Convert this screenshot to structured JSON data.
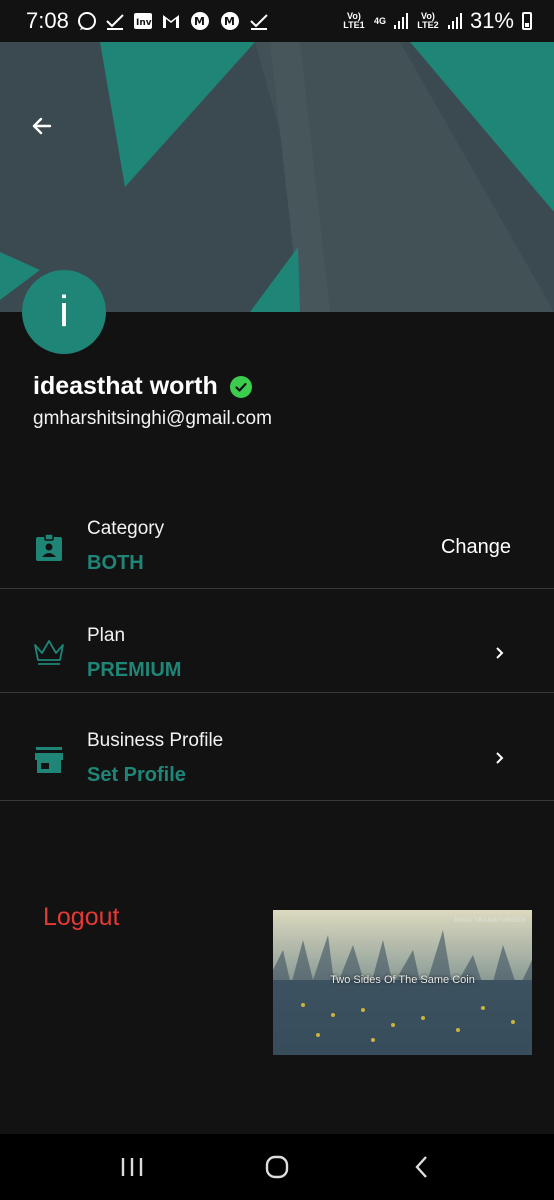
{
  "status_bar": {
    "time": "7:08",
    "battery": "31%",
    "sim1_label": "Vo) LTE1",
    "sim1_net": "4G",
    "sim2_label": "Vo) LTE2",
    "notification_icons": [
      "whatsapp-icon",
      "check-icon",
      "inv-icon",
      "gmail-icon",
      "m-icon",
      "m-icon",
      "check-icon"
    ]
  },
  "profile": {
    "avatar_letter": "i",
    "name": "ideasthat worth",
    "email": "gmharshitsinghi@gmail.com"
  },
  "settings": [
    {
      "id": "category",
      "title": "Category",
      "value": "BOTH",
      "action": "Change",
      "icon": "contact-badge-icon"
    },
    {
      "id": "plan",
      "title": "Plan",
      "value": "PREMIUM",
      "icon": "crown-icon"
    },
    {
      "id": "business",
      "title": "Business Profile",
      "value": "Set Profile",
      "icon": "store-icon"
    }
  ],
  "logout_label": "Logout",
  "video_overlay": {
    "caption": "Two Sides Of The Same Coin",
    "brand": "MIND TRANSFORMER"
  },
  "colors": {
    "accent": "#1e8577",
    "logout": "#e53935",
    "verified": "#3ccd4f",
    "background": "#121212"
  }
}
